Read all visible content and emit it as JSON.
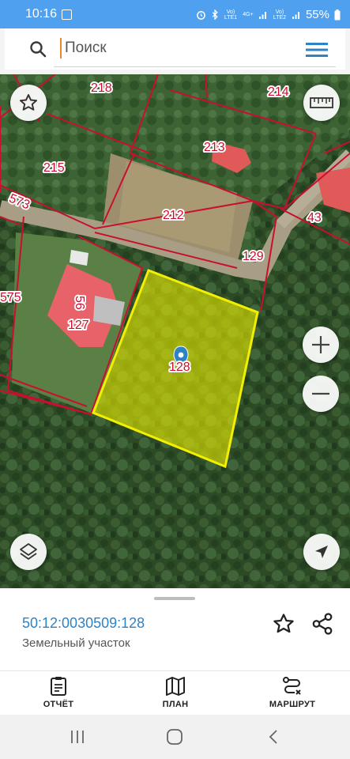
{
  "status_bar": {
    "time": "10:16",
    "network1": "Vo) LTE1",
    "network2": "4G+",
    "network3": "Vo) LTE2",
    "battery": "55%"
  },
  "search": {
    "placeholder": "Поиск"
  },
  "map": {
    "parcels": [
      "218",
      "214",
      "213",
      "215",
      "212",
      "573",
      "43",
      "129",
      "575",
      "56",
      "127",
      "128"
    ],
    "selected_parcel": "128"
  },
  "panel": {
    "cadastral_number": "50:12:0030509:128",
    "object_type": "Земельный участок"
  },
  "tabs": [
    {
      "label": "ОТЧЁТ",
      "icon": "report-icon"
    },
    {
      "label": "ПЛАН",
      "icon": "map-icon"
    },
    {
      "label": "МАРШРУТ",
      "icon": "route-icon"
    }
  ],
  "colors": {
    "status_bar": "#4fa0ee",
    "accent_blue": "#2f82c3",
    "parcel_border": "#c8102e",
    "selected_fill": "#e3e800"
  }
}
